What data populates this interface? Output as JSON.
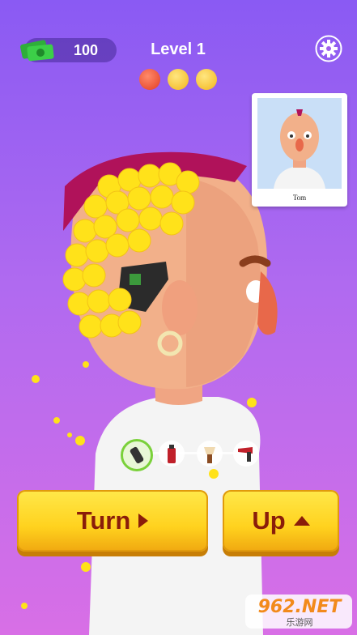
{
  "hud": {
    "cash_amount": "100",
    "cash_icon": "cash-stack-icon",
    "level_label": "Level 1",
    "settings_icon": "gear-icon",
    "mood_emojis": [
      "angry-face-icon",
      "grinning-face-icon",
      "grinning-face-icon"
    ]
  },
  "reference_card": {
    "name": "Tom"
  },
  "tools": [
    {
      "name": "clipper-icon",
      "active": true
    },
    {
      "name": "spray-can-icon",
      "active": false
    },
    {
      "name": "brush-icon",
      "active": false
    },
    {
      "name": "hair-dryer-icon",
      "active": false
    }
  ],
  "buttons": {
    "turn_label": "Turn",
    "up_label": "Up"
  },
  "watermark": {
    "text": "962.NET",
    "sub": "乐游网"
  },
  "colors": {
    "bg_top": "#8a5af3",
    "bg_bottom": "#d86fe6",
    "button_yellow": "#ffd21e",
    "button_text": "#8a1d0a",
    "hair_curls": "#ffe21a",
    "mohawk": "#b0125a"
  }
}
